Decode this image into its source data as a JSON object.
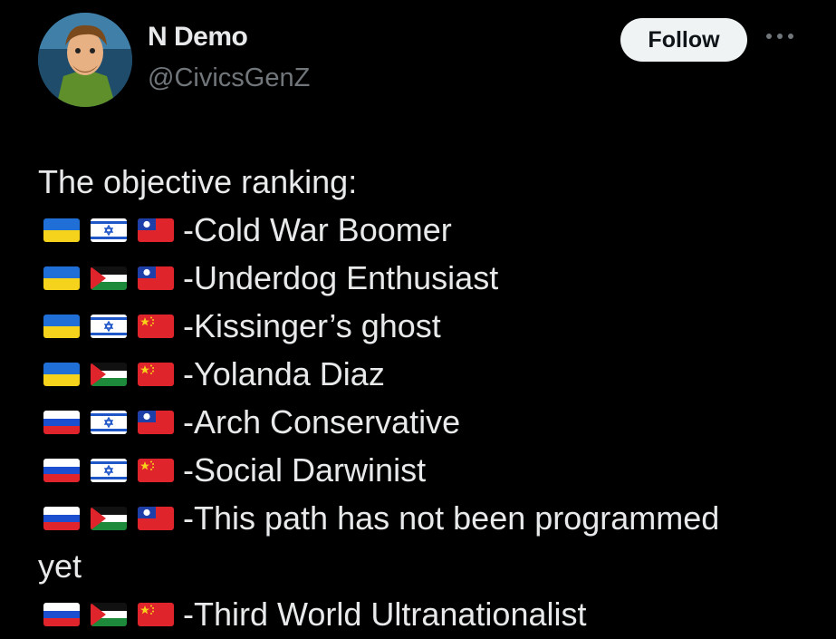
{
  "author": {
    "name": "N Demo",
    "handle": "@CivicsGenZ"
  },
  "follow_label": "Follow",
  "tweet": {
    "intro": "The objective ranking:",
    "rankings": [
      {
        "flags": [
          "ukraine-flag-icon",
          "israel-flag-icon",
          "taiwan-flag-icon"
        ],
        "label": "-Cold War Boomer"
      },
      {
        "flags": [
          "ukraine-flag-icon",
          "palestine-flag-icon",
          "taiwan-flag-icon"
        ],
        "label": "-Underdog Enthusiast"
      },
      {
        "flags": [
          "ukraine-flag-icon",
          "israel-flag-icon",
          "china-flag-icon"
        ],
        "label": "-Kissinger’s ghost"
      },
      {
        "flags": [
          "ukraine-flag-icon",
          "palestine-flag-icon",
          "china-flag-icon"
        ],
        "label": "-Yolanda Diaz"
      },
      {
        "flags": [
          "russia-flag-icon",
          "israel-flag-icon",
          "taiwan-flag-icon"
        ],
        "label": "-Arch Conservative"
      },
      {
        "flags": [
          "russia-flag-icon",
          "israel-flag-icon",
          "china-flag-icon"
        ],
        "label": "-Social Darwinist"
      },
      {
        "flags": [
          "russia-flag-icon",
          "palestine-flag-icon",
          "taiwan-flag-icon"
        ],
        "label": "-This path has not been programmed",
        "continuation": "yet"
      },
      {
        "flags": [
          "russia-flag-icon",
          "palestine-flag-icon",
          "china-flag-icon"
        ],
        "label": "-Third World Ultranationalist"
      }
    ]
  }
}
